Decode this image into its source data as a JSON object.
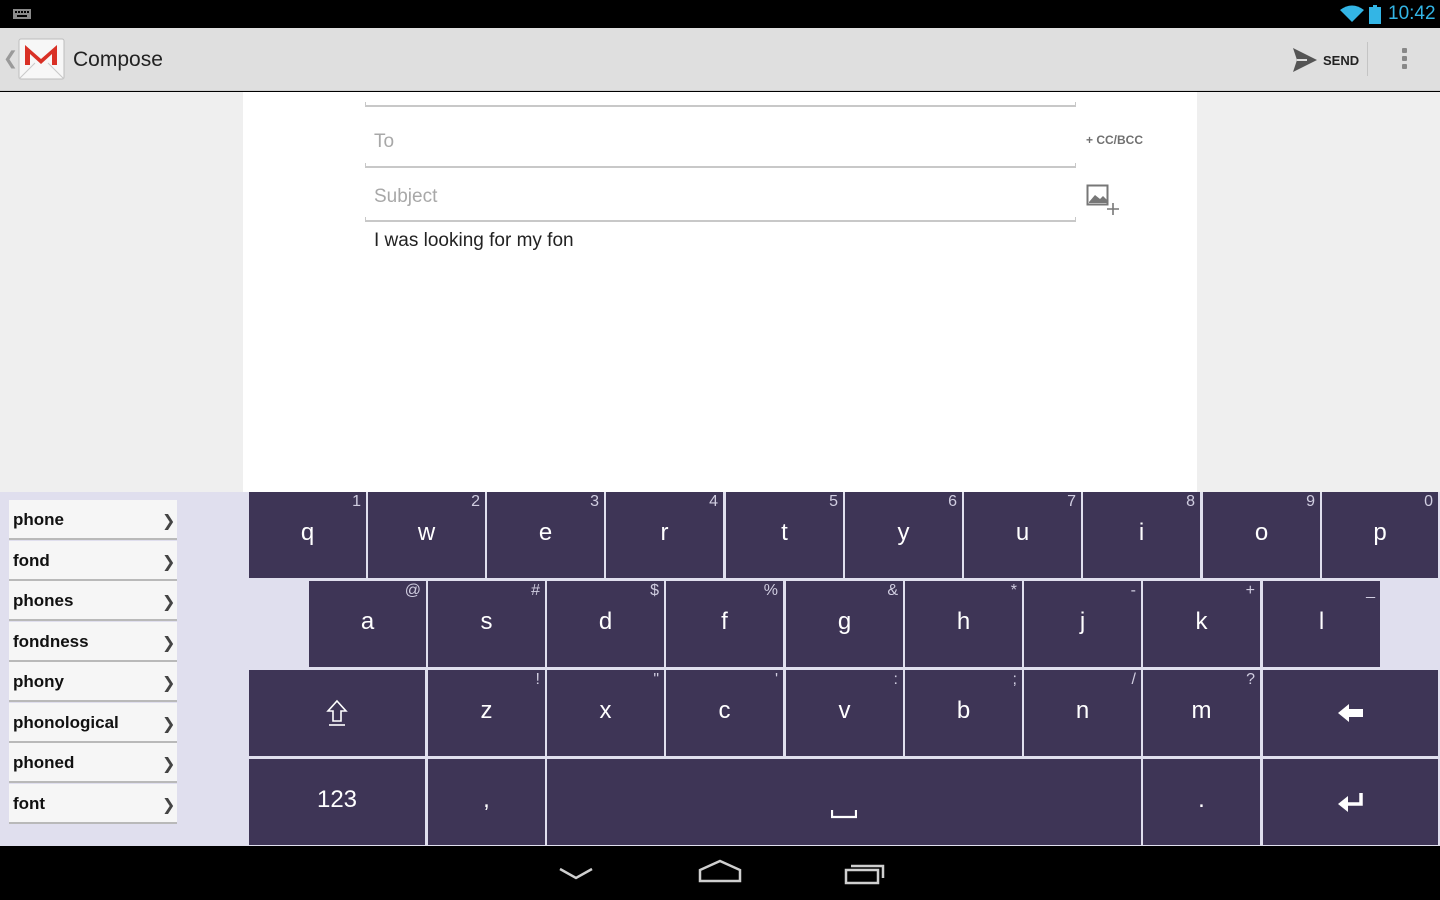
{
  "status_bar": {
    "time": "10:42",
    "icons": [
      "keyboard-icon",
      "wifi-icon",
      "battery-icon"
    ]
  },
  "action_bar": {
    "title": "Compose",
    "send_label": "SEND",
    "icons": [
      "up-chevron-icon",
      "gmail-logo",
      "send-icon",
      "overflow-menu-icon"
    ]
  },
  "compose": {
    "to_placeholder": "To",
    "cc_bcc_label": "+ CC/BCC",
    "subject_placeholder": "Subject",
    "body_text": "I was looking for my fon"
  },
  "suggestions": [
    {
      "word": "phone",
      "arrow": "❯"
    },
    {
      "word": "fond",
      "arrow": "❯"
    },
    {
      "word": "phones",
      "arrow": "❯"
    },
    {
      "word": "fondness",
      "arrow": "❯"
    },
    {
      "word": "phony",
      "arrow": "❯"
    },
    {
      "word": "phonological",
      "arrow": "❯"
    },
    {
      "word": "phoned",
      "arrow": "❯"
    },
    {
      "word": "font",
      "arrow": "❯"
    }
  ],
  "keyboard": {
    "row1": [
      {
        "main": "q",
        "alt": "1"
      },
      {
        "main": "w",
        "alt": "2"
      },
      {
        "main": "e",
        "alt": "3"
      },
      {
        "main": "r",
        "alt": "4"
      },
      {
        "main": "t",
        "alt": "5"
      },
      {
        "main": "y",
        "alt": "6"
      },
      {
        "main": "u",
        "alt": "7"
      },
      {
        "main": "i",
        "alt": "8"
      },
      {
        "main": "o",
        "alt": "9"
      },
      {
        "main": "p",
        "alt": "0"
      }
    ],
    "row2": [
      {
        "main": "a",
        "alt": "@"
      },
      {
        "main": "s",
        "alt": "#"
      },
      {
        "main": "d",
        "alt": "$"
      },
      {
        "main": "f",
        "alt": "%"
      },
      {
        "main": "g",
        "alt": "&"
      },
      {
        "main": "h",
        "alt": "*"
      },
      {
        "main": "j",
        "alt": "-"
      },
      {
        "main": "k",
        "alt": "+"
      },
      {
        "main": "l",
        "alt": "_"
      }
    ],
    "row3": [
      {
        "main": "z",
        "alt": "!"
      },
      {
        "main": "x",
        "alt": "\""
      },
      {
        "main": "c",
        "alt": "'"
      },
      {
        "main": "v",
        "alt": ":"
      },
      {
        "main": "b",
        "alt": ";"
      },
      {
        "main": "n",
        "alt": "/"
      },
      {
        "main": "m",
        "alt": "?"
      }
    ],
    "numbers_label": "123",
    "comma_label": ",",
    "period_label": ".",
    "key_colors": {
      "key": "#3e3556",
      "background": "#e0dfee"
    },
    "icons": [
      "shift-icon",
      "backspace-icon",
      "space-icon",
      "enter-icon"
    ]
  },
  "nav_bar": {
    "icons": [
      "back-icon",
      "home-icon",
      "recents-icon"
    ]
  }
}
